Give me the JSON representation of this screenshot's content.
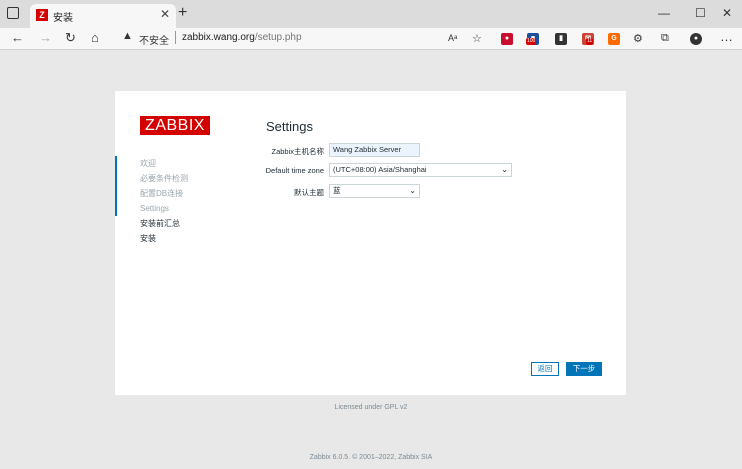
{
  "browser": {
    "tab_title": "安装",
    "tab_favicon": "Z",
    "url_security": "不安全",
    "url_host": "zabbix.wang.org",
    "url_path": "/setup.php",
    "badges": [
      "100",
      "11"
    ]
  },
  "logo": "ZABBIX",
  "steps": [
    {
      "label": "欢迎",
      "state": "done"
    },
    {
      "label": "必要条件检测",
      "state": "done"
    },
    {
      "label": "配置DB连接",
      "state": "done"
    },
    {
      "label": "Settings",
      "state": "active"
    },
    {
      "label": "安装前汇总",
      "state": "todo"
    },
    {
      "label": "安装",
      "state": "todo"
    }
  ],
  "main": {
    "title": "Settings",
    "fields": {
      "server_name_label": "Zabbix主机名称",
      "server_name_value": "Wang Zabbix  Server",
      "timezone_label": "Default time zone",
      "timezone_value": "(UTC+08:00) Asia/Shanghai",
      "theme_label": "默认主题",
      "theme_value": "蓝"
    },
    "back_label": "返回",
    "next_label": "下一步"
  },
  "license": "Licensed under GPL v2",
  "footer": "Zabbix 6.0.5. © 2001–2022, Zabbix SIA",
  "colors": {
    "brand": "#d40000",
    "accent": "#0275b8"
  }
}
